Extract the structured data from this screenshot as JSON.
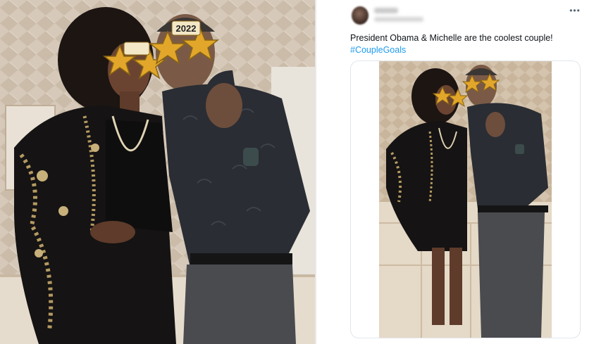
{
  "tweet": {
    "text": "President Obama & Michelle are the coolest couple!",
    "hashtag": "#CoupleGoals",
    "more_icon": "more-horizontal-icon"
  },
  "photo": {
    "glasses_label": "2022"
  },
  "colors": {
    "text": "#0f1419",
    "link": "#1d9bf0",
    "border": "#e1e6ea",
    "muted": "#536471"
  }
}
